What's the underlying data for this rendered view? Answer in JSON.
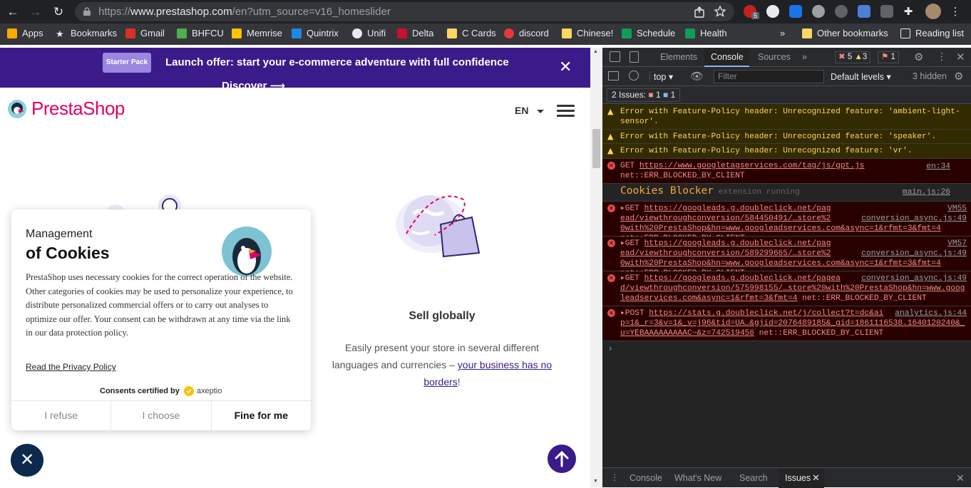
{
  "browser": {
    "url_prefix": "https://",
    "url_domain": "www.prestashop.com",
    "url_path": "/en?utm_source=v16_homeslider",
    "ext_badge": "5"
  },
  "bookmarks": {
    "items": [
      "Apps",
      "Bookmarks",
      "Gmail",
      "BHFCU",
      "Memrise",
      "Quintrix",
      "Unifi",
      "Delta",
      "C Cards",
      "discord",
      "Chinese!",
      "Schedule",
      "Health"
    ],
    "more": "»",
    "other": "Other bookmarks",
    "reading": "Reading list"
  },
  "banner": {
    "starter": "Starter Pack",
    "text": "Launch offer: start your e-commerce adventure with full confidence",
    "discover": "Discover ⟶"
  },
  "site": {
    "logo": "PrestaShop",
    "lang": "EN"
  },
  "feature": {
    "title": "Sell globally",
    "desc_before": "Easily present your store in several different languages and currencies – ",
    "desc_link": "your business has no borders",
    "desc_after": "!"
  },
  "cookie": {
    "mgmt": "Management",
    "title": "of Cookies",
    "body": "PrestaShop uses necessary cookies for the correct operation of the website. Other categories of cookies may be used to personalize your experience, to distribute personalized commercial offers or to carry out analyses to optimize our offer. Your consent can be withdrawn at any time via the link in our data protection policy.",
    "privacy": "Read the Privacy Policy",
    "certified": "Consents certified by",
    "brand": "axeptio",
    "refuse": "I refuse",
    "choose": "I choose",
    "accept": "Fine for me"
  },
  "devtools": {
    "tabs": [
      "Elements",
      "Console",
      "Sources"
    ],
    "more": "»",
    "counts": {
      "errors": "5",
      "warnings": "3",
      "issues": "1"
    },
    "context": "top",
    "filter": "Filter",
    "levels": "Default levels",
    "hidden": "3 hidden",
    "issues_label": "2 Issues:",
    "issues_a": "1",
    "issues_b": "1",
    "logs": [
      {
        "type": "warn",
        "text": "Error with Feature-Policy header: Unrecognized feature: 'ambient-light-sensor'."
      },
      {
        "type": "warn",
        "text": "Error with Feature-Policy header: Unrecognized feature: 'speaker'."
      },
      {
        "type": "warn",
        "text": "Error with Feature-Policy header: Unrecognized feature: 'vr'."
      },
      {
        "type": "err",
        "verb": "GET ",
        "url": "https://www.googletagservices.com/tag/js/gpt.js",
        "src": "en:34",
        "tail": "net::ERR_BLOCKED_BY_CLIENT"
      },
      {
        "type": "info",
        "title": "Cookies Blocker",
        "sub": "extension running",
        "src": "main.js:26"
      },
      {
        "type": "err",
        "verb": "▸GET ",
        "url": "https://googleads.g.doubleclick.net/pagead/viewthroughconversion/584450491/…store%20with%20PrestaShop&hn=www.googleadservices.com&async=1&rfmt=3&fmt=4",
        "src": "VM55 conversion_async.js:49",
        "tail": "net::ERR_BLOCKED_BY_CLIENT"
      },
      {
        "type": "err",
        "verb": "▸GET ",
        "url": "https://googleads.g.doubleclick.net/pagead/viewthroughconversion/589299665/…store%20with%20PrestaShop&hn=www.googleadservices.com&async=1&rfmt=3&fmt=4",
        "src": "VM57 conversion_async.js:49",
        "tail": "net::ERR_BLOCKED_BY_CLIENT"
      },
      {
        "type": "err",
        "verb": "▸GET ",
        "url": "https://googleads.g.doubleclick.net/pagead/viewthroughconversion/575998155/…store%20with%20PrestaShop&hn=www.googleadservices.com&async=1&rfmt=3&fmt=4",
        "src": "conversion_async.js:49",
        "tail": "net::ERR_BLOCKED_BY_CLIENT"
      },
      {
        "type": "err",
        "verb": "▸POST ",
        "url": "https://stats.g.doubleclick.net/j/collect?t=dc&aip=1&_r=3&v=1&_v=j96&tid=UA…&gjid=2076489185&_gid=1861116538.1640120240&_u=YEBAAAAAAAAAC~&z=742519456",
        "src": "analytics.js:44",
        "tail": "net::ERR_BLOCKED_BY_CLIENT"
      }
    ],
    "prompt": "›",
    "bottom_tabs": [
      "Console",
      "What's New",
      "Search",
      "Issues"
    ]
  }
}
